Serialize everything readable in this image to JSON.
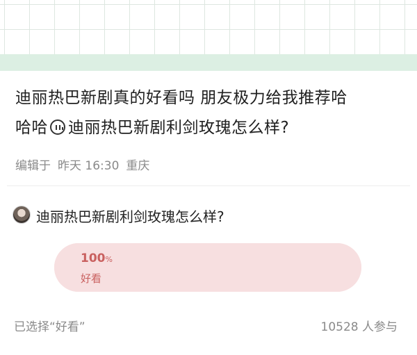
{
  "post": {
    "line1": "迪丽热巴新剧真的好看吗 朋友极力给我推荐哈",
    "line2_prefix": "哈哈",
    "line2_emoji": "speech-bubble-emoji-icon",
    "line2_suffix": "迪丽热巴新剧利剑玫瑰怎么样?",
    "edited": "编辑于",
    "time": "昨天 16:30",
    "location": "重庆"
  },
  "poll": {
    "question": "迪丽热巴新剧利剑玫瑰怎么样?",
    "option": {
      "percent": "100",
      "percent_unit": "%",
      "label": "好看",
      "fraction": 1.0
    },
    "selected_text": "已选择“好看”",
    "participants": "10528 人参与"
  },
  "colors": {
    "banner": "#dcefe3",
    "option_bg": "#f7dfe0",
    "option_text": "#c9605f"
  }
}
